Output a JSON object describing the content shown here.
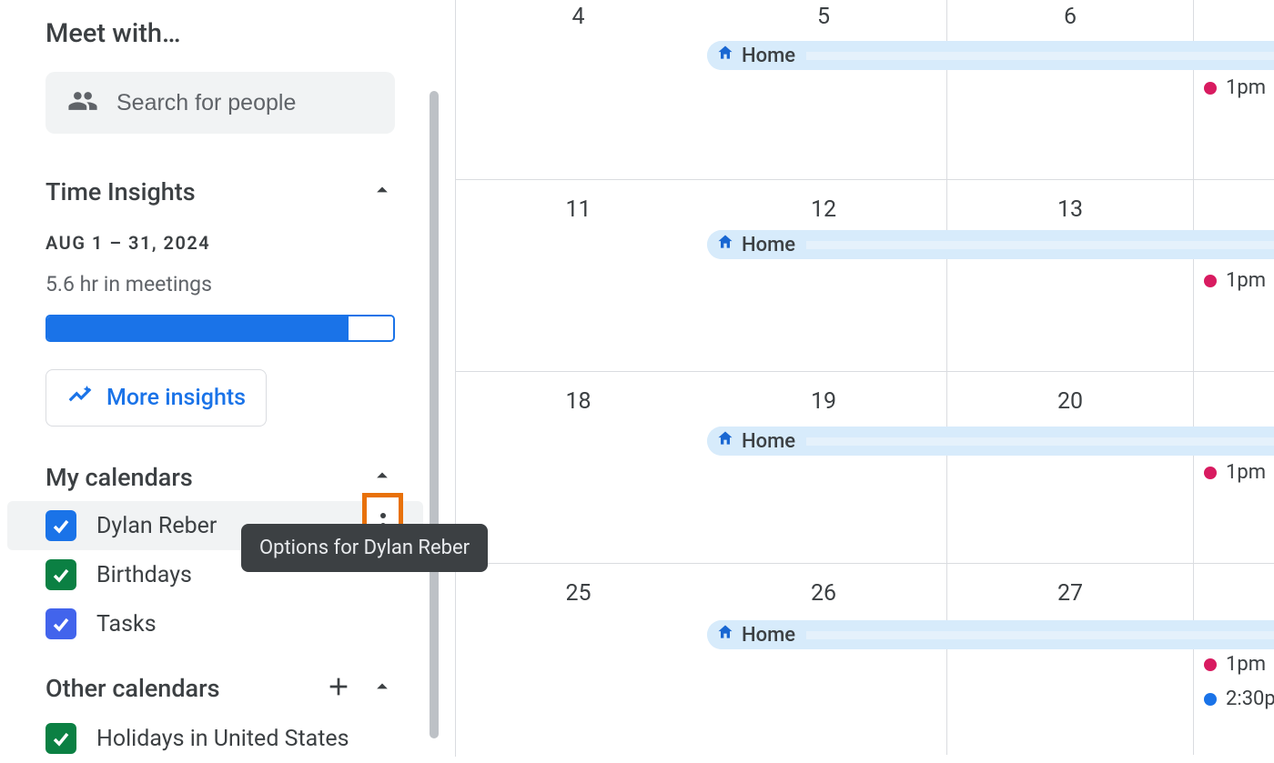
{
  "meet": {
    "title": "Meet with…",
    "search_placeholder": "Search for people"
  },
  "insights": {
    "title": "Time Insights",
    "date_range": "AUG 1 – 31, 2024",
    "meeting_hours": "5.6 hr in meetings",
    "progress_pct": 87,
    "more_btn": "More insights"
  },
  "my_calendars": {
    "title": "My calendars",
    "items": [
      {
        "label": "Dylan Reber",
        "color": "#1a73e8",
        "hovered": true
      },
      {
        "label": "Birthdays",
        "color": "#0b8043"
      },
      {
        "label": "Tasks",
        "color": "#4264ec"
      }
    ]
  },
  "other_calendars": {
    "title": "Other calendars",
    "items": [
      {
        "label": "Holidays in United States",
        "color": "#0b8043"
      }
    ]
  },
  "tooltip": "Options for Dylan Reber",
  "grid": {
    "rows": [
      {
        "days": [
          "4",
          "5",
          "6",
          ""
        ],
        "home": true,
        "events_col3": [
          {
            "c": "pink",
            "t": "1pm"
          }
        ]
      },
      {
        "days": [
          "11",
          "12",
          "13",
          ""
        ],
        "home": true,
        "events_col3": [
          {
            "c": "pink",
            "t": "1pm"
          }
        ]
      },
      {
        "days": [
          "18",
          "19",
          "20",
          ""
        ],
        "home": true,
        "events_col3": [
          {
            "c": "pink",
            "t": "1pm"
          }
        ]
      },
      {
        "days": [
          "25",
          "26",
          "27",
          ""
        ],
        "home": true,
        "events_col3": [
          {
            "c": "pink",
            "t": "1pm"
          },
          {
            "c": "blue",
            "t": "2:30p"
          }
        ]
      }
    ],
    "home_label": "Home"
  }
}
